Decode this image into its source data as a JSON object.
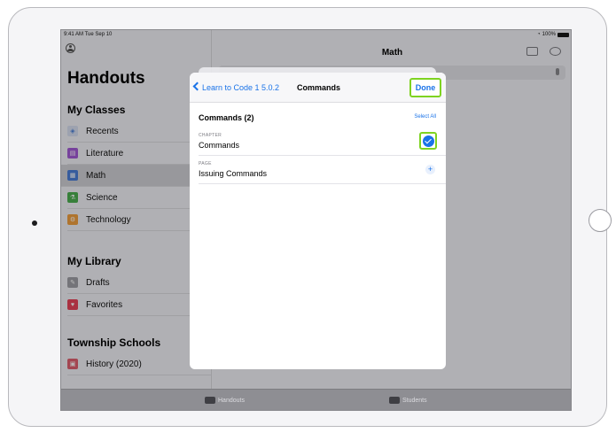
{
  "status": {
    "time": "9:41 AM  Tue Sep 10",
    "battery": "100%"
  },
  "sidebar": {
    "title": "Handouts",
    "sections": [
      {
        "heading": "My Classes",
        "items": [
          {
            "label": "Recents",
            "icon": "stack-icon",
            "color": "#d7dff0"
          },
          {
            "label": "Literature",
            "icon": "book-icon",
            "color": "#a45bd6"
          },
          {
            "label": "Math",
            "icon": "calculator-icon",
            "color": "#4a7fd8",
            "selected": true
          },
          {
            "label": "Science",
            "icon": "flask-icon",
            "color": "#4caf50"
          },
          {
            "label": "Technology",
            "icon": "gear-icon",
            "color": "#f0a040"
          }
        ]
      },
      {
        "heading": "My Library",
        "items": [
          {
            "label": "Drafts",
            "icon": "edit-icon",
            "color": "#a0a0a6"
          },
          {
            "label": "Favorites",
            "icon": "heart-icon",
            "color": "#e8445a"
          }
        ]
      },
      {
        "heading": "Township Schools",
        "items": [
          {
            "label": "History (2020)",
            "icon": "history-icon",
            "color": "#e06070"
          }
        ]
      }
    ]
  },
  "main": {
    "title": "Math"
  },
  "modal": {
    "back_label": "Learn to Code 1 5.0.2",
    "title": "Commands",
    "done_label": "Done",
    "list_heading": "Commands (2)",
    "select_all": "Select All",
    "rows": [
      {
        "caption": "CHAPTER",
        "label": "Commands",
        "state": "checked"
      },
      {
        "caption": "PAGE",
        "label": "Issuing Commands",
        "state": "add"
      }
    ]
  },
  "tabbar": {
    "tabs": [
      {
        "label": "Handouts",
        "icon": "layers-icon"
      },
      {
        "label": "Students",
        "icon": "people-icon"
      }
    ]
  },
  "colors": {
    "accent": "#1a73e8",
    "highlight": "#7ed321"
  }
}
